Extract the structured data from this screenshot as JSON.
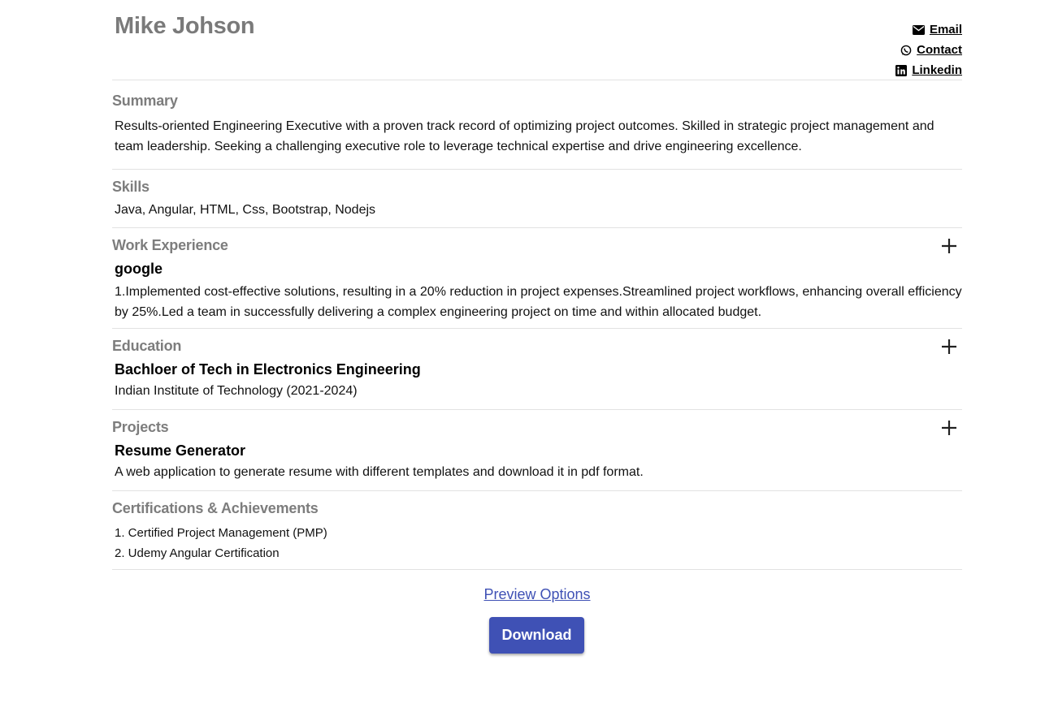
{
  "resume": {
    "name": "Mike Johson",
    "links": {
      "email": "Email",
      "contact": "Contact",
      "linkedin": "Linkedin"
    },
    "summary": {
      "title": "Summary",
      "text": "Results-oriented Engineering Executive with a proven track record of optimizing project outcomes. Skilled in strategic project management and team leadership. Seeking a challenging executive role to leverage technical expertise and drive engineering excellence."
    },
    "skills": {
      "title": "Skills",
      "text": "Java, Angular, HTML, Css, Bootstrap, Nodejs"
    },
    "work_experience": {
      "title": "Work Experience",
      "company": "google",
      "description": "1.Implemented cost-effective solutions, resulting in a 20% reduction in project expenses.Streamlined project workflows, enhancing overall efficiency by 25%.Led a team in successfully delivering a complex engineering project on time and within allocated budget."
    },
    "education": {
      "title": "Education",
      "degree": "Bachloer of Tech in Electronics Engineering",
      "institute": "Indian Institute of Technology (2021-2024)"
    },
    "projects": {
      "title": "Projects",
      "name": "Resume Generator",
      "description": "A web application to generate resume with different templates and download it in pdf format."
    },
    "certifications": {
      "title": "Certifications & Achievements",
      "items": [
        "1. Certified Project Management (PMP)",
        "2. Udemy Angular Certification"
      ]
    }
  },
  "actions": {
    "preview_label": "Preview Options",
    "download_label": "Download"
  },
  "colors": {
    "accent": "#3f51b5",
    "heading_gray": "#7d7d7d"
  },
  "icons": {
    "email": "envelope-icon",
    "contact": "whatsapp-icon",
    "linkedin": "linkedin-icon",
    "expand": "plus-icon"
  }
}
